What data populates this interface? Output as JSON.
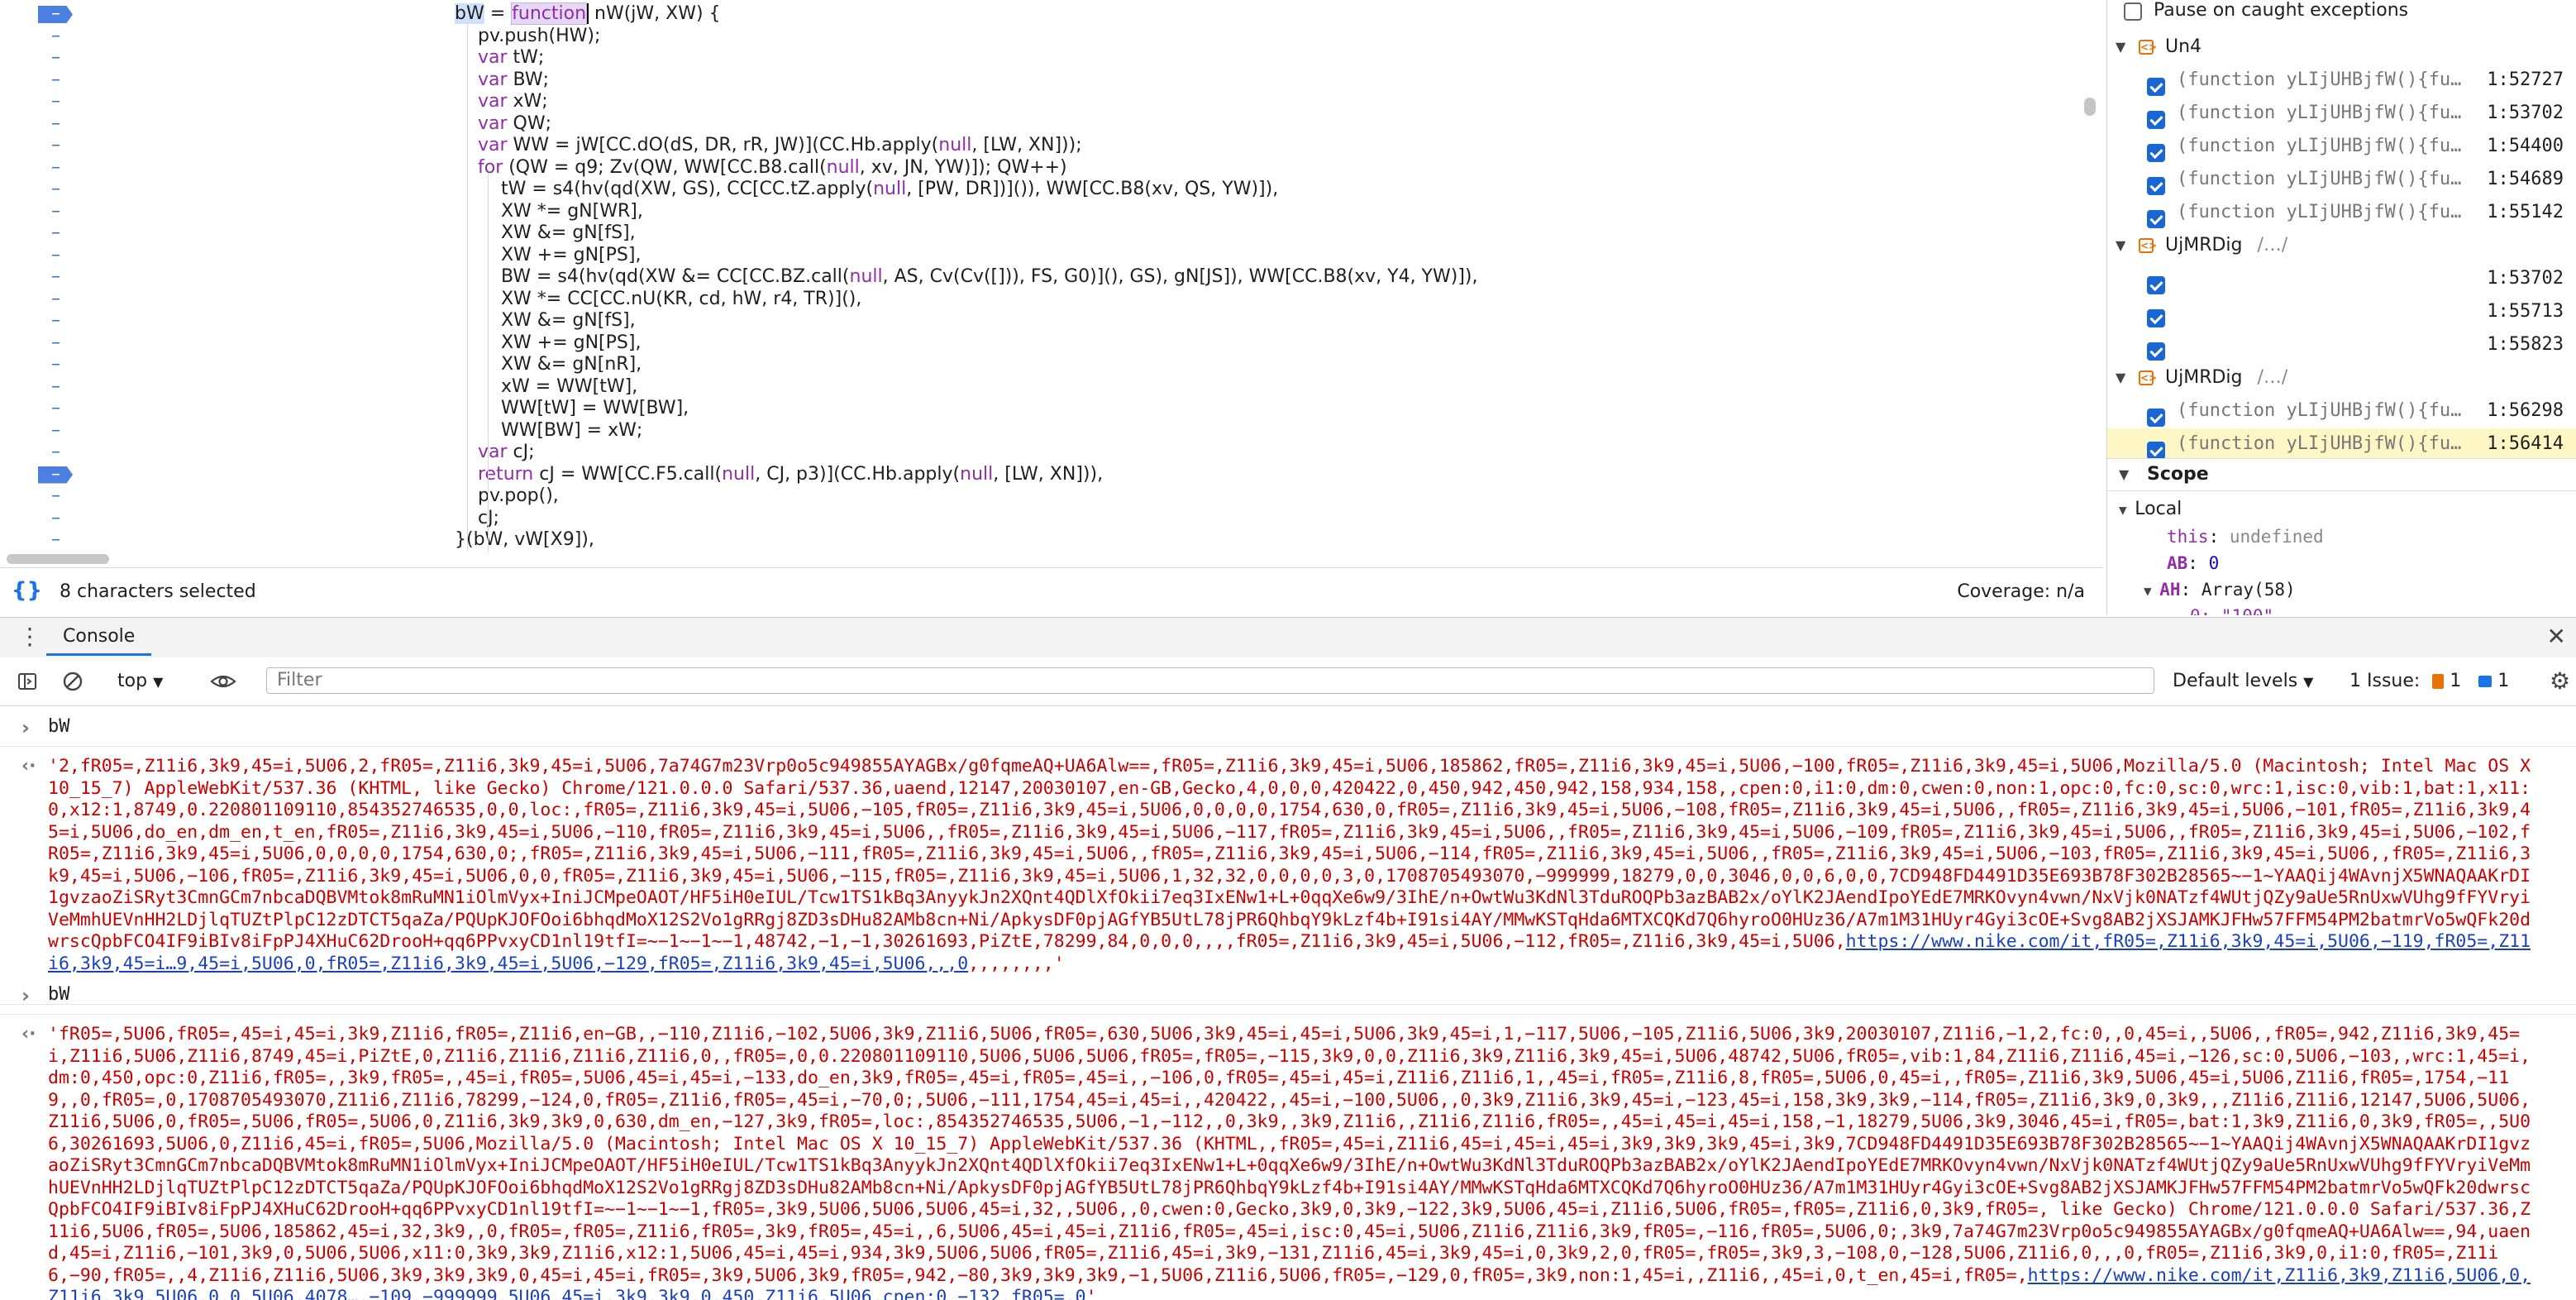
{
  "source": {
    "lines": [
      {
        "bp": true,
        "indent": 0,
        "html_key": "l0"
      },
      {
        "bp": false,
        "indent": 1
      },
      {
        "bp": false,
        "indent": 1
      },
      {
        "bp": false,
        "indent": 1
      },
      {
        "bp": false,
        "indent": 1
      },
      {
        "bp": false,
        "indent": 1
      },
      {
        "bp": false,
        "indent": 1
      },
      {
        "bp": false,
        "indent": 1
      },
      {
        "bp": false,
        "indent": 2
      },
      {
        "bp": false,
        "indent": 2
      },
      {
        "bp": false,
        "indent": 2
      },
      {
        "bp": false,
        "indent": 2
      },
      {
        "bp": false,
        "indent": 2
      },
      {
        "bp": false,
        "indent": 2
      },
      {
        "bp": false,
        "indent": 2
      },
      {
        "bp": false,
        "indent": 2
      },
      {
        "bp": false,
        "indent": 2
      },
      {
        "bp": false,
        "indent": 2
      },
      {
        "bp": false,
        "indent": 2
      },
      {
        "bp": false,
        "indent": 2
      },
      {
        "bp": false,
        "indent": 1
      },
      {
        "bp": true,
        "indent": 1
      },
      {
        "bp": false,
        "indent": 1
      },
      {
        "bp": false,
        "indent": 1
      },
      {
        "bp": false,
        "indent": 0
      }
    ],
    "text": [
      "bW = function nW(jW, XW) {",
      "    pv.push(HW);",
      "    var tW;",
      "    var BW;",
      "    var xW;",
      "    var QW;",
      "    var WW = jW[CC.dO(dS, DR, rR, JW)](CC.Hb.apply(null, [LW, XN]));",
      "    for (QW = q9; Zv(QW, WW[CC.B8.call(null, xv, JN, YW)]); QW++)",
      "        tW = s4(hv(qd(XW, GS), CC[CC.tZ.apply(null, [PW, DR])]()), WW[CC.B8(xv, QS, YW)]),",
      "        XW *= gN[WR],",
      "        XW &= gN[fS],",
      "        XW += gN[PS],",
      "        BW = s4(hv(qd(XW &= CC[CC.BZ.call(null, AS, Cv(Cv([])), FS, G0)](), GS), gN[JS]), WW[CC.B8(xv, Y4, YW)]),",
      "        XW *= CC[CC.nU(KR, cd, hW, r4, TR)](),",
      "        XW &= gN[fS],",
      "        XW += gN[PS],",
      "        XW &= gN[nR],",
      "        xW = WW[tW],",
      "        WW[tW] = WW[BW],",
      "        WW[BW] = xW;",
      "    var cJ;",
      "    return cJ = WW[CC.F5.call(null, CJ, p3)](CC.Hb.apply(null, [LW, XN])),",
      "    pv.pop(),",
      "    cJ;",
      "}(bW, vW[X9]),"
    ],
    "highlight_word": "function",
    "dash_glyph": "–"
  },
  "status": {
    "selection": "8 characters selected",
    "coverage": "Coverage: n/a",
    "braces_icon": "{}"
  },
  "sidebar": {
    "pause_label": "Pause on caught exceptions",
    "groups": [
      {
        "name": "Un4",
        "path": "",
        "items": [
          {
            "text": "(function yLIjUHBjfW(){fu…",
            "line": "1:52727",
            "hl": false
          },
          {
            "text": "(function yLIjUHBjfW(){fu…",
            "line": "1:53702",
            "hl": false
          },
          {
            "text": "(function yLIjUHBjfW(){fu…",
            "line": "1:54400",
            "hl": false
          },
          {
            "text": "(function yLIjUHBjfW(){fu…",
            "line": "1:54689",
            "hl": false
          },
          {
            "text": "(function yLIjUHBjfW(){fu…",
            "line": "1:55142",
            "hl": false
          }
        ]
      },
      {
        "name": "UjMRDig",
        "path": "/…/",
        "items": [
          {
            "text": "",
            "line": "1:53702",
            "hl": false
          },
          {
            "text": "",
            "line": "1:55713",
            "hl": false
          },
          {
            "text": "",
            "line": "1:55823",
            "hl": false
          }
        ]
      },
      {
        "name": "UjMRDig",
        "path": "/…/",
        "items": [
          {
            "text": "(function yLIjUHBjfW(){fu…",
            "line": "1:56298",
            "hl": false
          },
          {
            "text": "(function yLIjUHBjfW(){fu…",
            "line": "1:56414",
            "hl": true
          }
        ]
      }
    ],
    "scope_label": "Scope",
    "local_label": "Local",
    "scope_vars": [
      {
        "key": "this",
        "value": "undefined",
        "kind": "u"
      },
      {
        "key": "AB",
        "value": "0",
        "kind": "n"
      },
      {
        "key": "AH",
        "value": "Array(58)",
        "kind": "plain"
      }
    ],
    "partial_line": "0: \"100\""
  },
  "drawer": {
    "tab_label": "Console",
    "context": "top",
    "filter_placeholder": "Filter",
    "levels": "Default levels",
    "issues_label": "1 Issue:",
    "issue_warn_count": "1",
    "issue_info_count": "1"
  },
  "console": {
    "entries": [
      {
        "prompt": "bW",
        "result": "'2,fR05=,Z11i6,3k9,45=i,5U06,2,fR05=,Z11i6,3k9,45=i,5U06,7a74G7m23Vrp0o5c949855AYAGBx/g0fqmeAQ+UA6Alw==,fR05=,Z11i6,3k9,45=i,5U06,185862,fR05=,Z11i6,3k9,45=i,5U06,−100,fR05=,Z11i6,3k9,45=i,5U06,Mozilla/5.0 (Macintosh; Intel Mac OS X 10_15_7) AppleWebKit/537.36 (KHTML, like Gecko) Chrome/121.0.0.0 Safari/537.36,uaend,12147,20030107,en-GB,Gecko,4,0,0,0,420422,0,450,942,450,942,158,934,158,,cpen:0,i1:0,dm:0,cwen:0,non:1,opc:0,fc:0,sc:0,wrc:1,isc:0,vib:1,bat:1,x11:0,x12:1,8749,0.220801109110,854352746535,0,0,loc:,fR05=,Z11i6,3k9,45=i,5U06,−105,fR05=,Z11i6,3k9,45=i,5U06,0,0,0,0,1754,630,0,fR05=,Z11i6,3k9,45=i,5U06,−108,fR05=,Z11i6,3k9,45=i,5U06,,fR05=,Z11i6,3k9,45=i,5U06,−101,fR05=,Z11i6,3k9,45=i,5U06,do_en,dm_en,t_en,fR05=,Z11i6,3k9,45=i,5U06,−110,fR05=,Z11i6,3k9,45=i,5U06,,fR05=,Z11i6,3k9,45=i,5U06,−117,fR05=,Z11i6,3k9,45=i,5U06,,fR05=,Z11i6,3k9,45=i,5U06,−109,fR05=,Z11i6,3k9,45=i,5U06,,fR05=,Z11i6,3k9,45=i,5U06,−102,fR05=,Z11i6,3k9,45=i,5U06,0,0,0,0,1754,630,0;,fR05=,Z11i6,3k9,45=i,5U06,−111,fR05=,Z11i6,3k9,45=i,5U06,,fR05=,Z11i6,3k9,45=i,5U06,−114,fR05=,Z11i6,3k9,45=i,5U06,,fR05=,Z11i6,3k9,45=i,5U06,−103,fR05=,Z11i6,3k9,45=i,5U06,,fR05=,Z11i6,3k9,45=i,5U06,−106,fR05=,Z11i6,3k9,45=i,5U06,0,0,fR05=,Z11i6,3k9,45=i,5U06,−115,fR05=,Z11i6,3k9,45=i,5U06,1,32,32,0,0,0,0,3,0,1708705493070,−999999,18279,0,0,3046,0,0,6,0,0,7CD948FD4491D35E693B78F302B28565~−1~YAAQij4WAvnjX5WNAQAAKrDI1gvzaoZiSRyt3CmnGCm7nbcaDQBVMtok8mRuMN1iOlmVyx+IniJCMpeOAOT/HF5iH0eIUL/Tcw1TS1kBq3AnyykJn2XQnt4QDlXfOkii7eq3IxENw1+L+0qqXe6w9/3IhE/n+OwtWu3KdNl3TduROQPb3azBAB2x/oYlK2JAendIpoYEdE7MRKOvyn4vwn/NxVjk0NATzf4WUtjQZy9aUe5RnUxwVUhg9fFYVryiVeMmhUEVnHH2LDjlqTUZtPlpC12zDTCT5qaZa/PQUpKJOFOoi6bhqdMoX12S2Vo1gRRgj8ZD3sDHu82AMb8cn+Ni/ApkysDF0pjAGfYB5UtL78jPR6QhbqY9kLzf4b+I91si4AY/MMwKSTqHda6MTXCQKd7Q6hyroO0HUz36/A7m1M31HUyr4Gyi3cOE+Svg8AB2jXSJAMKJFHw57FFM54PM2batmrVo5wQFk20dwrscQpbFCO4IF9iBIv8iFpPJ4XHuC62DrooH+qq6PPvxyCD1nl19tfI=~−1~−1~−1,48742,−1,−1,30261693,PiZtE,78299,84,0,0,0,,,,fR05=,Z11i6,3k9,45=i,5U06,−112,fR05=,Z11i6,3k9,45=i,5U06,",
        "link": "https://www.nike.com/it,fR05=,Z11i6,3k9,45=i,5U06,−119,fR05=,Z11i6,3k9,45=i…9,45=i,5U06,0,fR05=,Z11i6,3k9,45=i,5U06,−129,fR05=,Z11i6,3k9,45=i,5U06,,,0",
        "tail": ",,,,,,,,'"
      },
      {
        "prompt": "bW",
        "result": "'fR05=,5U06,fR05=,45=i,45=i,3k9,Z11i6,fR05=,Z11i6,en−GB,,−110,Z11i6,−102,5U06,3k9,Z11i6,5U06,fR05=,630,5U06,3k9,45=i,45=i,5U06,3k9,45=i,1,−117,5U06,−105,Z11i6,5U06,3k9,20030107,Z11i6,−1,2,fc:0,,0,45=i,,5U06,,fR05=,942,Z11i6,3k9,45=i,Z11i6,5U06,Z11i6,8749,45=i,PiZtE,0,Z11i6,Z11i6,Z11i6,Z11i6,0,,fR05=,0,0.220801109110,5U06,5U06,5U06,fR05=,fR05=,−115,3k9,0,0,Z11i6,3k9,Z11i6,3k9,45=i,5U06,48742,5U06,fR05=,vib:1,84,Z11i6,Z11i6,45=i,−126,sc:0,5U06,−103,,wrc:1,45=i,dm:0,450,opc:0,Z11i6,fR05=,,3k9,fR05=,,45=i,fR05=,5U06,45=i,45=i,−133,do_en,3k9,fR05=,45=i,fR05=,45=i,,−106,0,fR05=,45=i,45=i,Z11i6,Z11i6,1,,45=i,fR05=,Z11i6,8,fR05=,5U06,0,45=i,,fR05=,Z11i6,3k9,5U06,45=i,5U06,Z11i6,fR05=,1754,−119,,0,fR05=,0,1708705493070,Z11i6,Z11i6,78299,−124,0,fR05=,Z11i6,fR05=,45=i,−70,0;,5U06,−111,1754,45=i,45=i,,420422,,45=i,−100,5U06,,0,3k9,Z11i6,3k9,45=i,−123,45=i,158,3k9,3k9,−114,fR05=,Z11i6,3k9,0,3k9,,,Z11i6,Z11i6,12147,5U06,5U06,Z11i6,5U06,0,fR05=,5U06,fR05=,5U06,0,Z11i6,3k9,3k9,0,630,dm_en,−127,3k9,fR05=,loc:,854352746535,5U06,−1,−112,,0,3k9,,3k9,Z11i6,,Z11i6,Z11i6,fR05=,,45=i,45=i,45=i,158,−1,18279,5U06,3k9,3046,45=i,fR05=,bat:1,3k9,Z11i6,0,3k9,fR05=,,5U06,30261693,5U06,0,Z11i6,45=i,fR05=,5U06,Mozilla/5.0 (Macintosh; Intel Mac OS X 10_15_7) AppleWebKit/537.36 (KHTML,,fR05=,45=i,Z11i6,45=i,45=i,45=i,3k9,3k9,3k9,45=i,3k9,7CD948FD4491D35E693B78F302B28565~−1~YAAQij4WAvnjX5WNAQAAKrDI1gvzaoZiSRyt3CmnGCm7nbcaDQBVMtok8mRuMN1iOlmVyx+IniJCMpeOAOT/HF5iH0eIUL/Tcw1TS1kBq3AnyykJn2XQnt4QDlXfOkii7eq3IxENw1+L+0qqXe6w9/3IhE/n+OwtWu3KdNl3TduROQPb3azBAB2x/oYlK2JAendIpoYEdE7MRKOvyn4vwn/NxVjk0NATzf4WUtjQZy9aUe5RnUxwVUhg9fFYVryiVeMmhUEVnHH2LDjlqTUZtPlpC12zDTCT5qaZa/PQUpKJOFOoi6bhqdMoX12S2Vo1gRRgj8ZD3sDHu82AMb8cn+Ni/ApkysDF0pjAGfYB5UtL78jPR6QhbqY9kLzf4b+I91si4AY/MMwKSTqHda6MTXCQKd7Q6hyroO0HUz36/A7m1M31HUyr4Gyi3cOE+Svg8AB2jXSJAMKJFHw57FFM54PM2batmrVo5wQFk20dwrscQpbFCO4IF9iBIv8iFpPJ4XHuC62DrooH+qq6PPvxyCD1nl19tfI=~−1~−1~−1,fR05=,3k9,5U06,5U06,5U06,45=i,32,,5U06,,0,cwen:0,Gecko,3k9,0,3k9,−122,3k9,5U06,45=i,Z11i6,5U06,fR05=,fR05=,Z11i6,0,3k9,fR05=, like Gecko) Chrome/121.0.0.0 Safari/537.36,Z11i6,5U06,fR05=,5U06,185862,45=i,32,3k9,,0,fR05=,fR05=,Z11i6,fR05=,3k9,fR05=,45=i,,6,5U06,45=i,45=i,Z11i6,fR05=,45=i,isc:0,45=i,5U06,Z11i6,Z11i6,3k9,fR05=,−116,fR05=,5U06,0;,3k9,7a74G7m23Vrp0o5c949855AYAGBx/g0fqmeAQ+UA6Alw==,94,uaend,45=i,Z11i6,−101,3k9,0,5U06,5U06,x11:0,3k9,3k9,Z11i6,x12:1,5U06,45=i,45=i,934,3k9,5U06,5U06,fR05=,Z11i6,45=i,3k9,−131,Z11i6,45=i,3k9,45=i,0,3k9,2,0,fR05=,fR05=,3k9,3,−108,0,−128,5U06,Z11i6,0,,,0,fR05=,Z11i6,3k9,0,i1:0,fR05=,Z11i6,−90,fR05=,,4,Z11i6,Z11i6,5U06,3k9,3k9,3k9,0,45=i,45=i,fR05=,3k9,5U06,3k9,fR05=,942,−80,3k9,3k9,3k9,−1,5U06,Z11i6,5U06,fR05=,−129,0,fR05=,3k9,non:1,45=i,,Z11i6,,45=i,0,t_en,45=i,fR05=,",
        "link": "https://www.nike.com/it,Z11i6,3k9,Z11i6,5U06,0,Z11i6,3k9,5U06,0,0,5U06,4078…,−109,−999999,5U06,45=i,3k9,3k9,0,450,Z11i6,5U06,cpen:0,−132,fR05=,0",
        "tail": "'"
      }
    ]
  }
}
